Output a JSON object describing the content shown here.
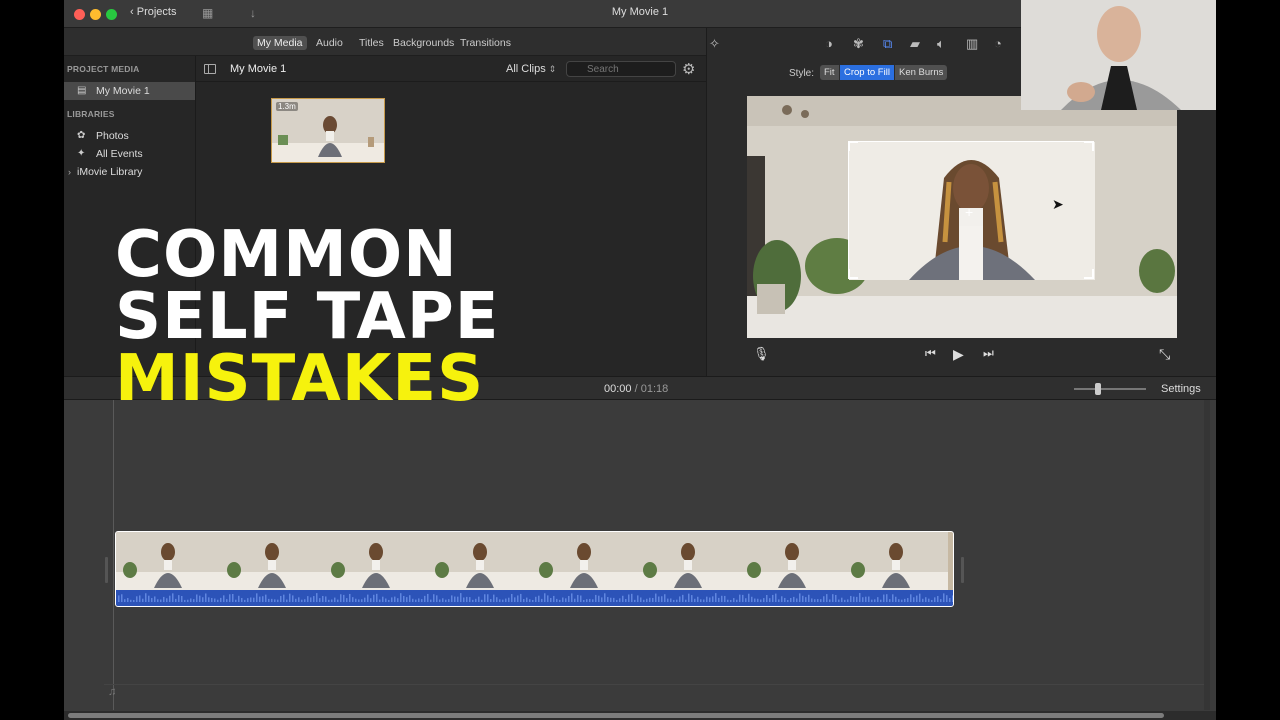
{
  "window": {
    "title": "My Movie 1",
    "projects_label": "Projects"
  },
  "browser_tabs": [
    {
      "label": "My Media",
      "active": true
    },
    {
      "label": "Audio",
      "active": false
    },
    {
      "label": "Titles",
      "active": false
    },
    {
      "label": "Backgrounds",
      "active": false
    },
    {
      "label": "Transitions",
      "active": false
    }
  ],
  "sidebar": {
    "project_media_header": "PROJECT MEDIA",
    "project_item": "My Movie 1",
    "libraries_header": "LIBRARIES",
    "photos": "Photos",
    "all_events": "All Events",
    "library": "iMovie Library"
  },
  "media_browser": {
    "title": "My Movie 1",
    "filter": "All Clips",
    "search_placeholder": "Search",
    "clip_duration": "1.3m"
  },
  "viewer": {
    "style_label": "Style:",
    "styles": [
      {
        "label": "Fit",
        "selected": false
      },
      {
        "label": "Crop to Fill",
        "selected": true
      },
      {
        "label": "Ken Burns",
        "selected": false
      }
    ]
  },
  "timeline": {
    "current_time": "00:00",
    "separator": "/",
    "total_time": "01:18",
    "settings_label": "Settings",
    "frame_count": 8
  },
  "overlay": {
    "line1": "COMMON",
    "line2": "SELF TAPE",
    "line3": "MISTAKES"
  },
  "colors": {
    "accent": "#2b6fe0",
    "headline_yellow": "#f6f20d",
    "audio_wave": "#2c53b8"
  }
}
